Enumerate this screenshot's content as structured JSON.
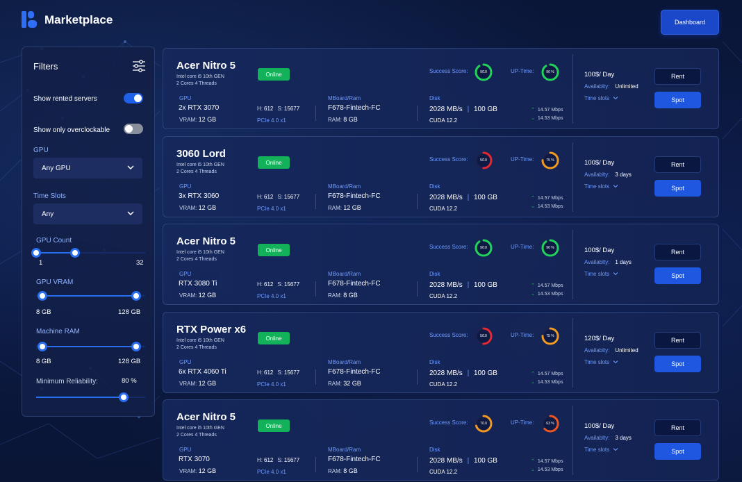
{
  "header": {
    "brand": "Marketplace",
    "dashboard_label": "Dashboard"
  },
  "filters": {
    "title": "Filters",
    "show_rented_label": "Show rented servers",
    "show_rented_on": true,
    "show_overclock_label": "Show only overclockable",
    "show_overclock_on": false,
    "gpu_label": "GPU",
    "gpu_value": "Any GPU",
    "timeslots_label": "Time Slots",
    "timeslots_value": "Any",
    "gpu_count": {
      "label": "GPU Count",
      "min_label": "1",
      "max_label": "32",
      "low": 1,
      "high": 12,
      "range": [
        1,
        32
      ]
    },
    "gpu_vram": {
      "label": "GPU VRAM",
      "min_label": "8 GB",
      "max_label": "128 GB",
      "low": 8,
      "high": 128,
      "range": [
        0,
        140
      ]
    },
    "machine_ram": {
      "label": "Machine RAM",
      "min_label": "8 GB",
      "max_label": "128 GB",
      "low": 8,
      "high": 128,
      "range": [
        0,
        140
      ]
    },
    "reliability": {
      "label": "Minimum Reliability:",
      "value_label": "80 %",
      "value": 80
    }
  },
  "labels": {
    "success_score": "Success Score:",
    "up_time": "UP-Time:",
    "gpu": "GPU",
    "vram": "VRAM:",
    "h": "H:",
    "s": "S:",
    "mboard": "MBoard/Ram",
    "ram": "RAM:",
    "disk": "Disk",
    "availability": "Availablty:",
    "time_slots": "Time slots",
    "rent": "Rent",
    "spot": "Spot",
    "online": "Online"
  },
  "servers": [
    {
      "name": "Acer Nitro 5",
      "cpu": "Intel core i5  10th GEN",
      "cores": "2 Cores  4 Threads",
      "gpu": "2x RTX 3070",
      "vram": "12 GB",
      "h": "612",
      "s": "15677",
      "pcie": "PCIe 4.0 x1",
      "mboard": "F678-Fintech-FC",
      "ram": "8 GB",
      "disk_speed": "2028 MB/s",
      "disk_size": "100 GB",
      "cuda": "CUDA 12.2",
      "up_speed": "14.57 Mbps",
      "down_speed": "14.53 Mbps",
      "success_label": "9/10",
      "success": 0.9,
      "success_color": "#22d35a",
      "uptime_label": "90 %",
      "uptime": 0.9,
      "uptime_color": "#22d35a",
      "price": "100$/ Day",
      "availability": "Unlimited"
    },
    {
      "name": "3060 Lord",
      "cpu": "Intel core i5  10th GEN",
      "cores": "2 Cores  4 Threads",
      "gpu": "3x RTX 3060",
      "vram": "12 GB",
      "h": "612",
      "s": "15677",
      "pcie": "PCIe 4.0 x1",
      "mboard": "F678-Fintech-FC",
      "ram": "12 GB",
      "disk_speed": "2028 MB/s",
      "disk_size": "100 GB",
      "cuda": "CUDA 12.2",
      "up_speed": "14.57 Mbps",
      "down_speed": "14.53 Mbps",
      "success_label": "5/10",
      "success": 0.5,
      "success_color": "#e8272e",
      "uptime_label": "75 %",
      "uptime": 0.75,
      "uptime_color": "#f29a1f",
      "price": "100$/ Day",
      "availability": "3 days"
    },
    {
      "name": "Acer Nitro 5",
      "cpu": "Intel core i5  10th GEN",
      "cores": "2 Cores  4 Threads",
      "gpu": "RTX 3080 Ti",
      "vram": "12 GB",
      "h": "612",
      "s": "15677",
      "pcie": "PCIe 4.0 x1",
      "mboard": "F678-Fintech-FC",
      "ram": "8 GB",
      "disk_speed": "2028 MB/s",
      "disk_size": "100 GB",
      "cuda": "CUDA 12.2",
      "up_speed": "14.57 Mbps",
      "down_speed": "14.53 Mbps",
      "success_label": "9/10",
      "success": 0.9,
      "success_color": "#22d35a",
      "uptime_label": "90 %",
      "uptime": 0.9,
      "uptime_color": "#22d35a",
      "price": "100$/ Day",
      "availability": "1 days"
    },
    {
      "name": "RTX Power x6",
      "cpu": "Intel core i5  10th GEN",
      "cores": "2 Cores  4 Threads",
      "gpu": "6x RTX 4060 Ti",
      "vram": "12 GB",
      "h": "612",
      "s": "15677",
      "pcie": "PCIe 4.0 x1",
      "mboard": "F678-Fintech-FC",
      "ram": "32 GB",
      "disk_speed": "2028 MB/s",
      "disk_size": "100 GB",
      "cuda": "CUDA 12.2",
      "up_speed": "14.57 Mbps",
      "down_speed": "14.53 Mbps",
      "success_label": "5/10",
      "success": 0.5,
      "success_color": "#e8272e",
      "uptime_label": "75 %",
      "uptime": 0.75,
      "uptime_color": "#f29a1f",
      "price": "120$/ Day",
      "availability": "Unlimited"
    },
    {
      "name": "Acer Nitro 5",
      "cpu": "Intel core i5  10th GEN",
      "cores": "2 Cores  4 Threads",
      "gpu": "RTX 3070",
      "vram": "12 GB",
      "h": "612",
      "s": "15677",
      "pcie": "PCIe 4.0 x1",
      "mboard": "F678-Fintech-FC",
      "ram": "8 GB",
      "disk_speed": "2028 MB/s",
      "disk_size": "100 GB",
      "cuda": "CUDA 12.2",
      "up_speed": "14.57 Mbps",
      "down_speed": "14.53 Mbps",
      "success_label": "7/10",
      "success": 0.7,
      "success_color": "#f29a1f",
      "uptime_label": "63 %",
      "uptime": 0.63,
      "uptime_color": "#f0561f",
      "price": "100$/ Day",
      "availability": "3 days"
    }
  ],
  "colors": {
    "accent": "#1f57e0",
    "online": "#13b15a",
    "label_blue": "#6f9bff",
    "ring_track": "#1a2350"
  }
}
